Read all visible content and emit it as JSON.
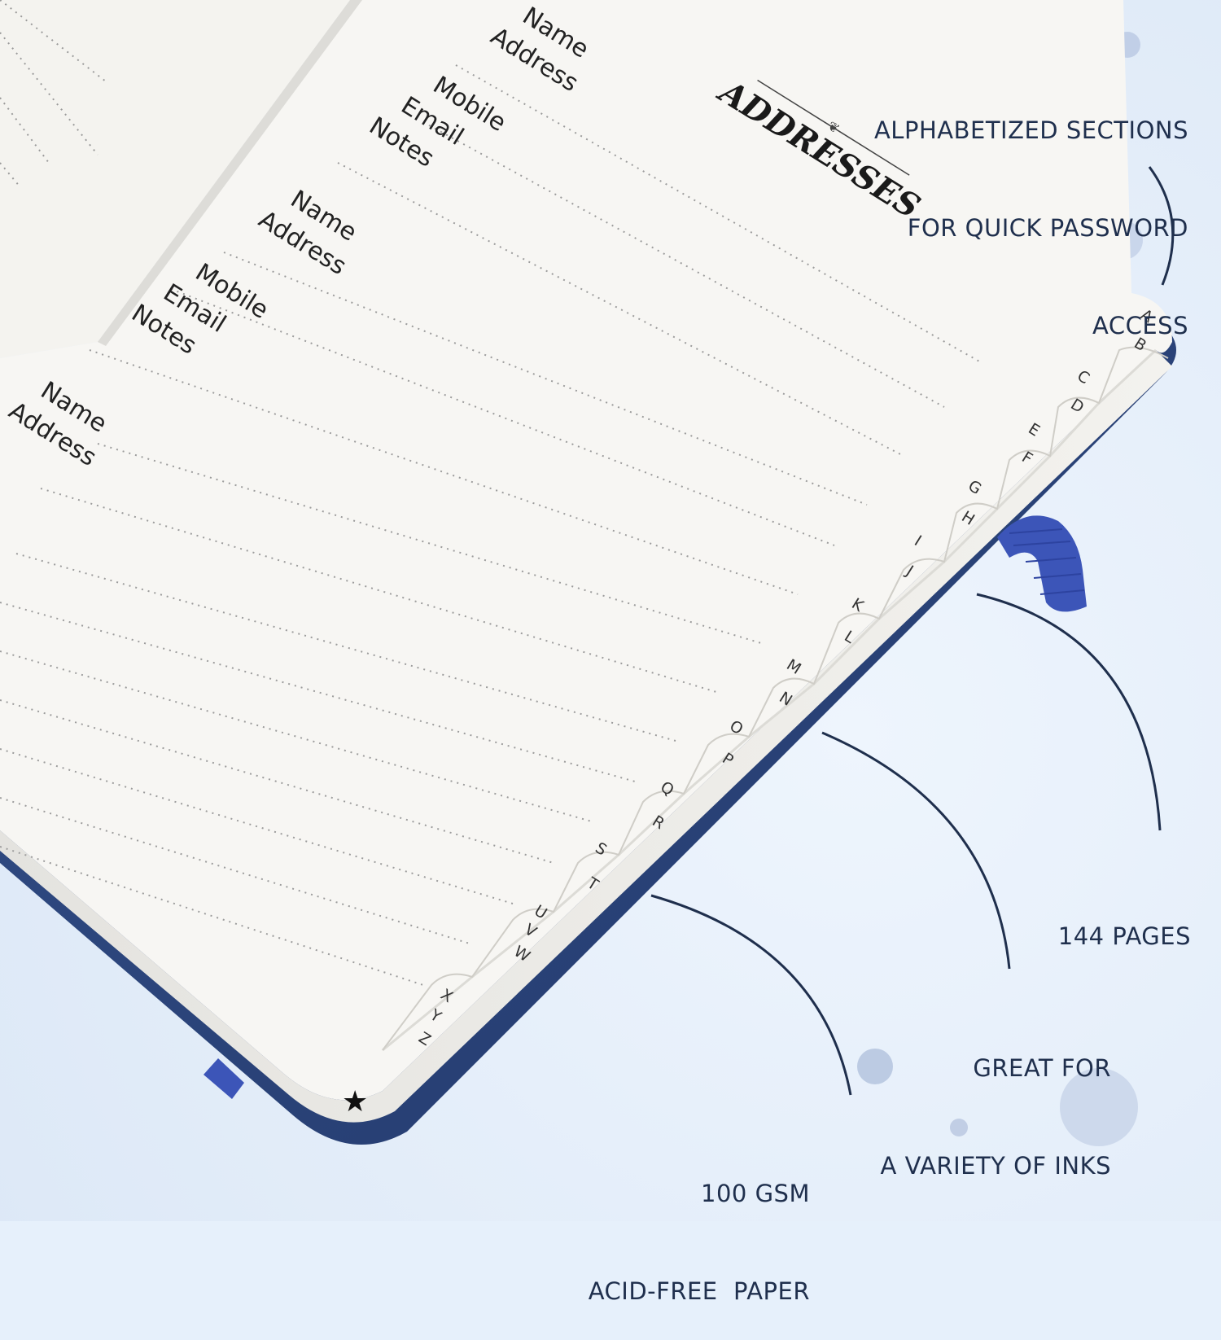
{
  "page_title": "ADDRESSES",
  "field_labels": [
    "Name",
    "Address",
    "Mobile",
    "Email",
    "Notes"
  ],
  "tabs": [
    "A",
    "B",
    "C",
    "D",
    "E",
    "F",
    "G",
    "H",
    "I",
    "J",
    "K",
    "L",
    "M",
    "N",
    "O",
    "P",
    "Q",
    "R",
    "S",
    "T",
    "U",
    "V",
    "W",
    "X",
    "Y",
    "Z",
    "★"
  ],
  "callouts": {
    "sections": [
      "ALPHABETIZED SECTIONS",
      "FOR QUICK PASSWORD",
      "ACCESS"
    ],
    "pages": [
      "144 PAGES"
    ],
    "inks": [
      "GREAT FOR",
      "A VARIETY OF INKS"
    ],
    "paper": [
      "100 GSM",
      "ACID-FREE  PAPER"
    ]
  },
  "colors": {
    "background": "#e6f0fb",
    "cover": "#2c4478",
    "elastic": "#3c55b8",
    "paper": "#f6f5f2",
    "callout_text": "#1f2f4d"
  }
}
